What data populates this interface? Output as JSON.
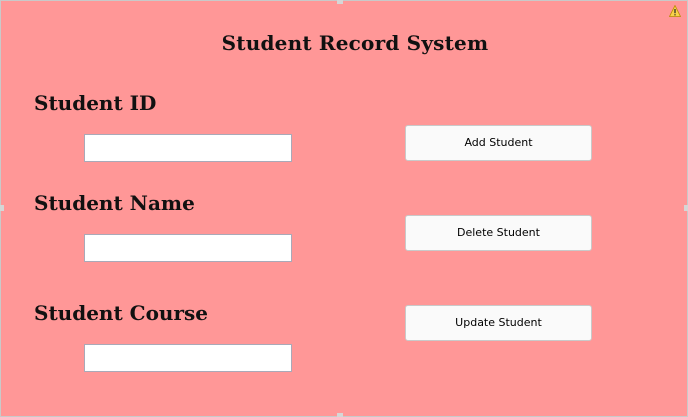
{
  "window": {
    "title": "Student Record System",
    "accent_color": "#ff9797",
    "warning_icon": "warning-icon"
  },
  "form": {
    "student_id": {
      "label": "Student ID",
      "value": ""
    },
    "student_name": {
      "label": "Student Name",
      "value": ""
    },
    "student_course": {
      "label": "Student Course",
      "value": ""
    }
  },
  "actions": {
    "add_label": "Add Student",
    "delete_label": "Delete Student",
    "update_label": "Update Student"
  }
}
